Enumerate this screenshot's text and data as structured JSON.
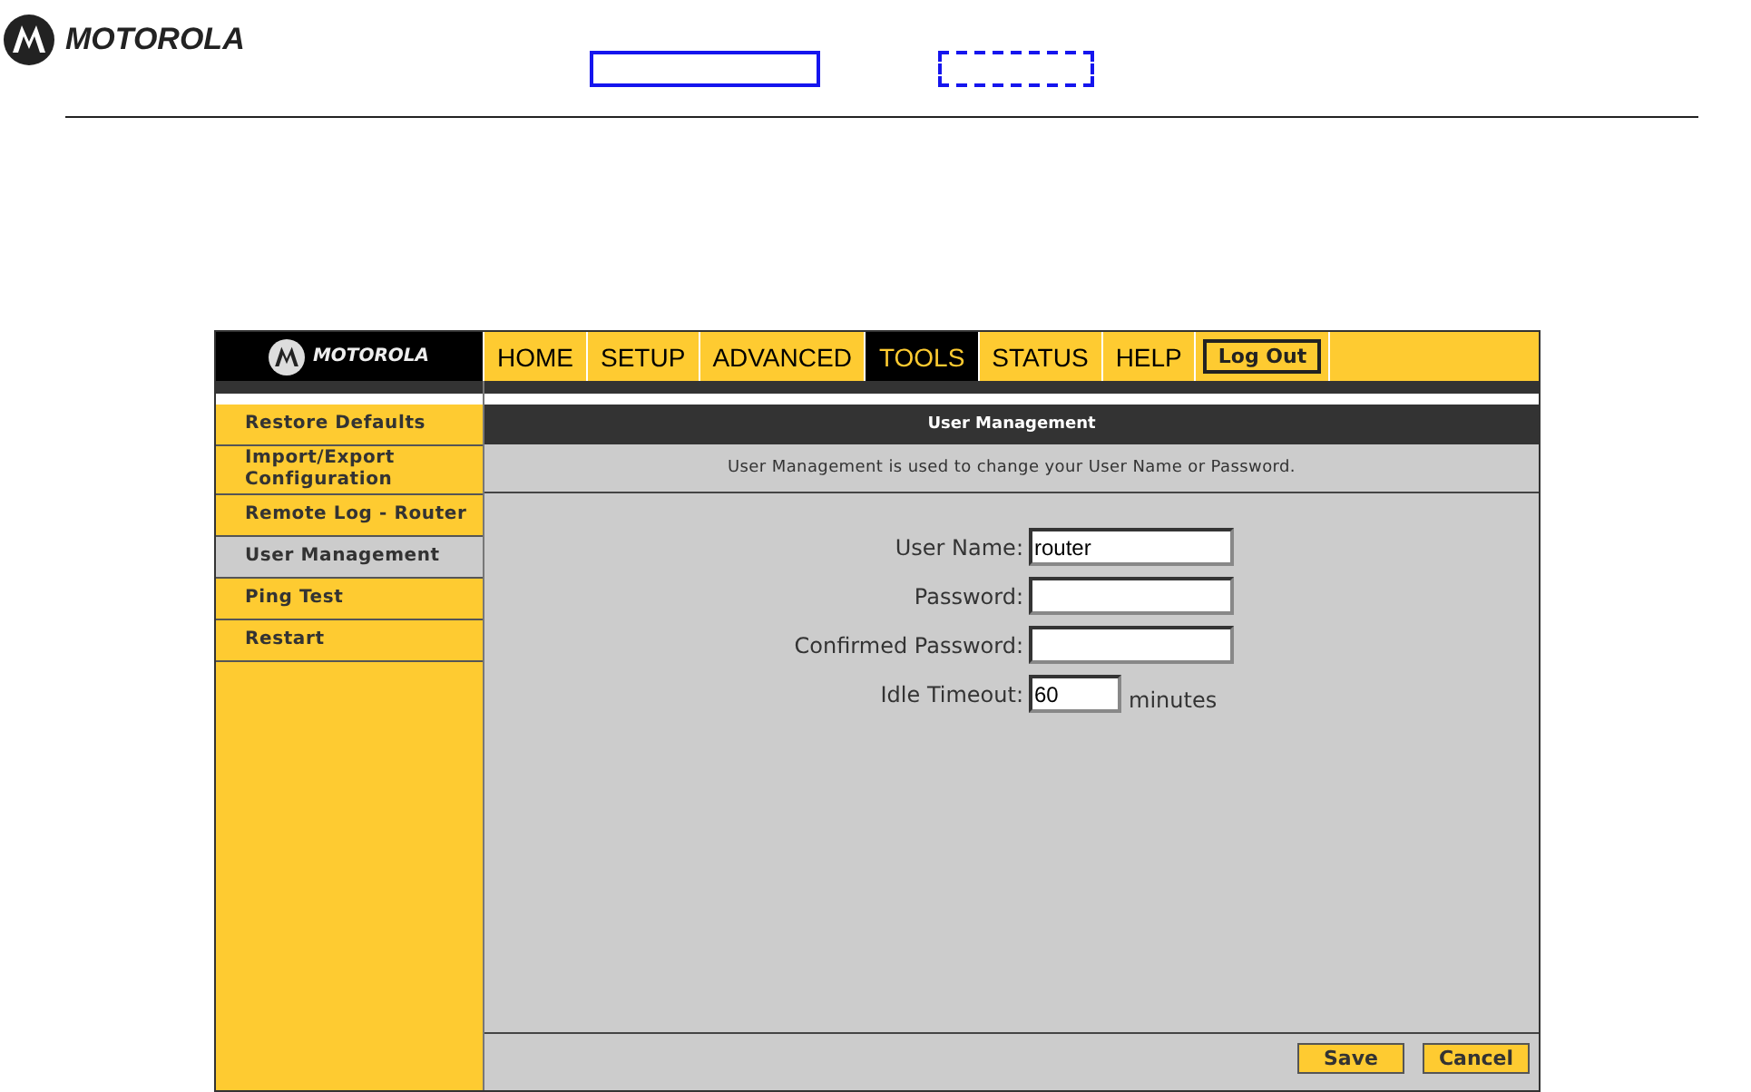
{
  "header": {
    "brand": "MOTOROLA"
  },
  "router": {
    "brand": "MOTOROLA",
    "tabs": [
      {
        "label": "HOME",
        "selected": false
      },
      {
        "label": "SETUP",
        "selected": false
      },
      {
        "label": "ADVANCED",
        "selected": false
      },
      {
        "label": "TOOLS",
        "selected": true
      },
      {
        "label": "STATUS",
        "selected": false
      },
      {
        "label": "HELP",
        "selected": false
      }
    ],
    "logout": "Log Out",
    "sidebar": {
      "items": [
        {
          "label": "Restore Defaults",
          "selected": false
        },
        {
          "label": "Import/Export Configuration",
          "selected": false
        },
        {
          "label": "Remote Log - Router",
          "selected": false
        },
        {
          "label": "User Management",
          "selected": true
        },
        {
          "label": "Ping Test",
          "selected": false
        },
        {
          "label": "Restart",
          "selected": false
        }
      ]
    },
    "panel": {
      "title": "User Management",
      "description": "User Management is used to change your User Name or Password.",
      "fields": [
        {
          "label": "User Name:",
          "value": "router",
          "kind": "text"
        },
        {
          "label": "Password:",
          "kind": "password"
        },
        {
          "label": "Confirmed Password:",
          "kind": "password"
        },
        {
          "label": "Idle Timeout:",
          "value": "60",
          "kind": "short",
          "unit": "minutes"
        }
      ]
    },
    "buttons": [
      "Save",
      "Cancel"
    ]
  }
}
